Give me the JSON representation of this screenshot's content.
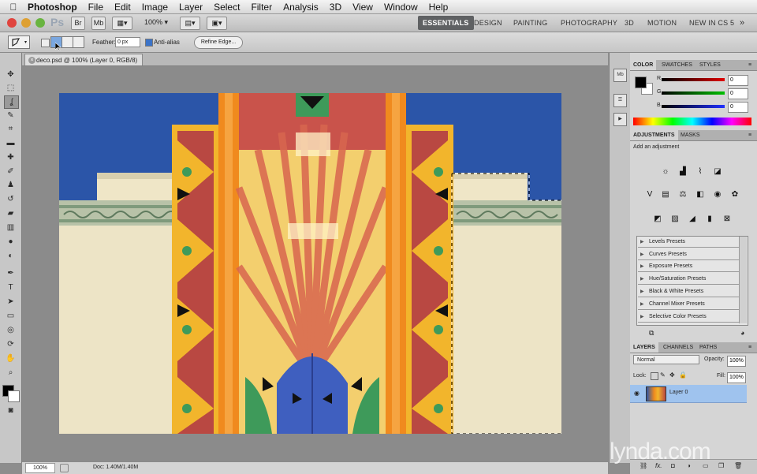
{
  "menubar": {
    "app_name": "Photoshop",
    "items": [
      "File",
      "Edit",
      "Image",
      "Layer",
      "Select",
      "Filter",
      "Analysis",
      "3D",
      "View",
      "Window",
      "Help"
    ]
  },
  "appbar": {
    "logo": "Ps",
    "bridge_label": "Mb",
    "zoom": "100%",
    "workspaces": [
      "ESSENTIALS",
      "DESIGN",
      "PAINTING",
      "PHOTOGRAPHY",
      "3D",
      "MOTION",
      "NEW IN CS 5"
    ],
    "overflow": "»"
  },
  "options": {
    "feather_label": "Feather:",
    "feather_value": "0 px",
    "antialias_label": "Anti-alias",
    "antialias_checked": true,
    "refine_edge_label": "Refine Edge..."
  },
  "document": {
    "tab_title": "deco.psd @ 100% (Layer 0, RGB/8)",
    "close_glyph": "×"
  },
  "status": {
    "zoom": "100%",
    "doc_size": "Doc: 1.40M/1.40M"
  },
  "color_panel": {
    "tabs": [
      "COLOR",
      "SWATCHES",
      "STYLES"
    ],
    "r_label": "R",
    "r_value": "0",
    "g_label": "G",
    "g_value": "0",
    "b_label": "B",
    "b_value": "0"
  },
  "adjustments_panel": {
    "tabs": [
      "ADJUSTMENTS",
      "MASKS"
    ],
    "title": "Add an adjustment",
    "presets": [
      "Levels Presets",
      "Curves Presets",
      "Exposure Presets",
      "Hue/Saturation Presets",
      "Black & White Presets",
      "Channel Mixer Presets",
      "Selective Color Presets"
    ]
  },
  "layers_panel": {
    "tabs": [
      "LAYERS",
      "CHANNELS",
      "PATHS"
    ],
    "blend_mode": "Normal",
    "opacity_label": "Opacity:",
    "opacity_value": "100%",
    "lock_label": "Lock:",
    "fill_label": "Fill:",
    "fill_value": "100%",
    "layers": [
      {
        "name": "Layer 0",
        "visible": true,
        "selected": true
      }
    ],
    "footer_fx": "fx."
  },
  "watermark": "lynda.com",
  "colors": {
    "sky": "#2b55a8",
    "cream": "#ece3c4",
    "orange": "#f08a1e",
    "gold": "#f2b52c",
    "red_tile": "#b94842",
    "green_tile": "#3e9a5a",
    "selected_layer": "#9fc3ee"
  }
}
